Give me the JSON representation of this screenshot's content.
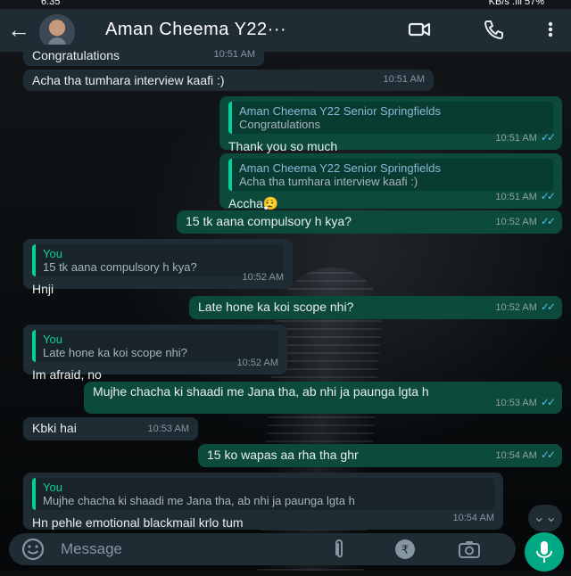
{
  "status_bar": {
    "time": "6:35",
    "indicators": "KB/s  .ıll  57%"
  },
  "header": {
    "back_icon": "arrow-left-icon",
    "contact_name": "Aman Cheema Y22···",
    "video_icon": "video-call-icon",
    "call_icon": "phone-icon",
    "menu_icon": "more-vert-icon"
  },
  "messages": [
    {
      "dir": "in",
      "text": "Congratulations",
      "time": "10:51 AM"
    },
    {
      "dir": "in",
      "text": "Acha tha tumhara interview kaafi :)",
      "time": "10:51 AM"
    },
    {
      "dir": "out",
      "quote_name": "Aman Cheema Y22 Senior Springfields",
      "quote_text": "Congratulations",
      "text": "Thank you so much",
      "time": "10:51 AM"
    },
    {
      "dir": "out",
      "quote_name": "Aman Cheema Y22 Senior Springfields",
      "quote_text": "Acha tha tumhara interview kaafi :)",
      "text": "Accha",
      "emoji": "😮‍💨",
      "time": "10:51 AM"
    },
    {
      "dir": "out",
      "text": "15 tk aana compulsory h kya?",
      "time": "10:52 AM"
    },
    {
      "dir": "in",
      "quote_name": "You",
      "quote_text": "15 tk aana compulsory h kya?",
      "text": "Hnji",
      "time": "10:52 AM"
    },
    {
      "dir": "out",
      "text": "Late hone ka koi scope nhi?",
      "time": "10:52 AM"
    },
    {
      "dir": "in",
      "quote_name": "You",
      "quote_text": "Late hone ka koi scope nhi?",
      "text": "Im afraid, no",
      "time": "10:52 AM"
    },
    {
      "dir": "out",
      "text": "Mujhe chacha ki shaadi me Jana tha, ab nhi ja paunga lgta h",
      "time": "10:53 AM"
    },
    {
      "dir": "in",
      "text": "Kbki hai",
      "time": "10:53 AM"
    },
    {
      "dir": "out",
      "text": "15 ko wapas aa rha tha ghr",
      "time": "10:54 AM"
    },
    {
      "dir": "in",
      "quote_name": "You",
      "quote_text": "Mujhe chacha ki shaadi me Jana tha, ab nhi ja paunga lgta h",
      "text": "Hn pehle emotional blackmail krlo tum",
      "time": "10:54 AM"
    }
  ],
  "composer": {
    "placeholder": "Message",
    "emoji_icon": "emoji-icon",
    "attach_icon": "paperclip-icon",
    "payment_icon": "rupee-icon",
    "camera_icon": "camera-icon",
    "mic_icon": "mic-icon",
    "scroll_icon": "double-chevron-down-icon"
  },
  "colors": {
    "header": "#1f2c34",
    "incoming": "#1f2c34",
    "outgoing": "#0c4a3b",
    "accent": "#00a884",
    "read_ticks": "#53bdeb"
  }
}
